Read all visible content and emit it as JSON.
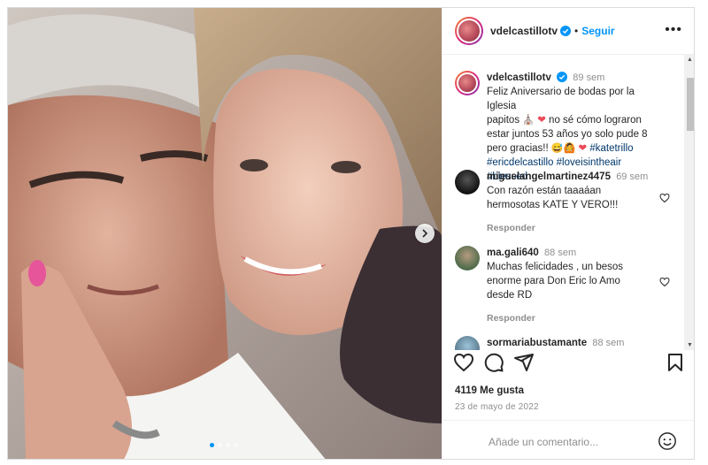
{
  "post": {
    "username": "vdelcastillotv",
    "separator": "•",
    "follow_label": "Seguir",
    "more_label": "•••",
    "caption": {
      "username": "vdelcastillotv",
      "time": "89 sem",
      "line1": "Feliz Aniversario de bodas por la Iglesia",
      "line2a": "papitos",
      "line2b": "no sé cómo lograron",
      "line3": "estar juntos 53 años yo solo pude 8",
      "line4": "pero gracias!!",
      "tag1": "#katetrillo",
      "tag2": "#ericdelcastillo",
      "tag3": "#loveisintheair",
      "tag4": "#blessed"
    },
    "comments": [
      {
        "user": "miguelangelmartinez4475",
        "time": "69 sem",
        "line1": "Con razón están taaaáan",
        "line2": "hermosotas KATE Y VERO!!!",
        "reply": "Responder"
      },
      {
        "user": "ma.gali640",
        "time": "88 sem",
        "line1": "Muchas felicidades , un besos",
        "line2": "enorme para Don Eric lo Amo",
        "line3": "desde RD",
        "reply": "Responder"
      },
      {
        "user": "sormariabustamante",
        "time": "88 sem"
      }
    ],
    "likes": "4119 Me gusta",
    "date": "23 de mayo de 2022",
    "comment_placeholder": "Añade un comentario...",
    "icons": [
      "verified-icon",
      "more-icon",
      "heart-icon",
      "comment-icon",
      "share-icon",
      "bookmark-icon",
      "emoji-icon",
      "chevron-right-icon"
    ],
    "colors": {
      "accent": "#0095f6",
      "like": "#ed4956",
      "text": "#262626",
      "muted": "#8e8e8e"
    },
    "carousel_total": 4,
    "carousel_active": 1
  }
}
